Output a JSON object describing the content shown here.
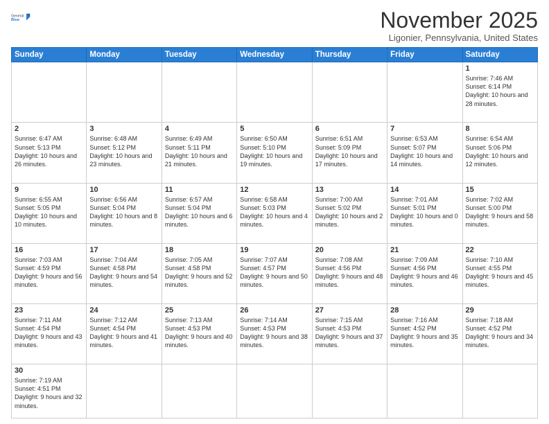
{
  "header": {
    "logo": {
      "line1": "General",
      "line2": "Blue"
    },
    "title": "November 2025",
    "location": "Ligonier, Pennsylvania, United States"
  },
  "weekdays": [
    "Sunday",
    "Monday",
    "Tuesday",
    "Wednesday",
    "Thursday",
    "Friday",
    "Saturday"
  ],
  "weeks": [
    [
      {
        "day": "",
        "info": ""
      },
      {
        "day": "",
        "info": ""
      },
      {
        "day": "",
        "info": ""
      },
      {
        "day": "",
        "info": ""
      },
      {
        "day": "",
        "info": ""
      },
      {
        "day": "",
        "info": ""
      },
      {
        "day": "1",
        "info": "Sunrise: 7:46 AM\nSunset: 6:14 PM\nDaylight: 10 hours\nand 28 minutes."
      }
    ],
    [
      {
        "day": "2",
        "info": "Sunrise: 6:47 AM\nSunset: 5:13 PM\nDaylight: 10 hours\nand 26 minutes."
      },
      {
        "day": "3",
        "info": "Sunrise: 6:48 AM\nSunset: 5:12 PM\nDaylight: 10 hours\nand 23 minutes."
      },
      {
        "day": "4",
        "info": "Sunrise: 6:49 AM\nSunset: 5:11 PM\nDaylight: 10 hours\nand 21 minutes."
      },
      {
        "day": "5",
        "info": "Sunrise: 6:50 AM\nSunset: 5:10 PM\nDaylight: 10 hours\nand 19 minutes."
      },
      {
        "day": "6",
        "info": "Sunrise: 6:51 AM\nSunset: 5:09 PM\nDaylight: 10 hours\nand 17 minutes."
      },
      {
        "day": "7",
        "info": "Sunrise: 6:53 AM\nSunset: 5:07 PM\nDaylight: 10 hours\nand 14 minutes."
      },
      {
        "day": "8",
        "info": "Sunrise: 6:54 AM\nSunset: 5:06 PM\nDaylight: 10 hours\nand 12 minutes."
      }
    ],
    [
      {
        "day": "9",
        "info": "Sunrise: 6:55 AM\nSunset: 5:05 PM\nDaylight: 10 hours\nand 10 minutes."
      },
      {
        "day": "10",
        "info": "Sunrise: 6:56 AM\nSunset: 5:04 PM\nDaylight: 10 hours\nand 8 minutes."
      },
      {
        "day": "11",
        "info": "Sunrise: 6:57 AM\nSunset: 5:04 PM\nDaylight: 10 hours\nand 6 minutes."
      },
      {
        "day": "12",
        "info": "Sunrise: 6:58 AM\nSunset: 5:03 PM\nDaylight: 10 hours\nand 4 minutes."
      },
      {
        "day": "13",
        "info": "Sunrise: 7:00 AM\nSunset: 5:02 PM\nDaylight: 10 hours\nand 2 minutes."
      },
      {
        "day": "14",
        "info": "Sunrise: 7:01 AM\nSunset: 5:01 PM\nDaylight: 10 hours\nand 0 minutes."
      },
      {
        "day": "15",
        "info": "Sunrise: 7:02 AM\nSunset: 5:00 PM\nDaylight: 9 hours\nand 58 minutes."
      }
    ],
    [
      {
        "day": "16",
        "info": "Sunrise: 7:03 AM\nSunset: 4:59 PM\nDaylight: 9 hours\nand 56 minutes."
      },
      {
        "day": "17",
        "info": "Sunrise: 7:04 AM\nSunset: 4:58 PM\nDaylight: 9 hours\nand 54 minutes."
      },
      {
        "day": "18",
        "info": "Sunrise: 7:05 AM\nSunset: 4:58 PM\nDaylight: 9 hours\nand 52 minutes."
      },
      {
        "day": "19",
        "info": "Sunrise: 7:07 AM\nSunset: 4:57 PM\nDaylight: 9 hours\nand 50 minutes."
      },
      {
        "day": "20",
        "info": "Sunrise: 7:08 AM\nSunset: 4:56 PM\nDaylight: 9 hours\nand 48 minutes."
      },
      {
        "day": "21",
        "info": "Sunrise: 7:09 AM\nSunset: 4:56 PM\nDaylight: 9 hours\nand 46 minutes."
      },
      {
        "day": "22",
        "info": "Sunrise: 7:10 AM\nSunset: 4:55 PM\nDaylight: 9 hours\nand 45 minutes."
      }
    ],
    [
      {
        "day": "23",
        "info": "Sunrise: 7:11 AM\nSunset: 4:54 PM\nDaylight: 9 hours\nand 43 minutes."
      },
      {
        "day": "24",
        "info": "Sunrise: 7:12 AM\nSunset: 4:54 PM\nDaylight: 9 hours\nand 41 minutes."
      },
      {
        "day": "25",
        "info": "Sunrise: 7:13 AM\nSunset: 4:53 PM\nDaylight: 9 hours\nand 40 minutes."
      },
      {
        "day": "26",
        "info": "Sunrise: 7:14 AM\nSunset: 4:53 PM\nDaylight: 9 hours\nand 38 minutes."
      },
      {
        "day": "27",
        "info": "Sunrise: 7:15 AM\nSunset: 4:53 PM\nDaylight: 9 hours\nand 37 minutes."
      },
      {
        "day": "28",
        "info": "Sunrise: 7:16 AM\nSunset: 4:52 PM\nDaylight: 9 hours\nand 35 minutes."
      },
      {
        "day": "29",
        "info": "Sunrise: 7:18 AM\nSunset: 4:52 PM\nDaylight: 9 hours\nand 34 minutes."
      }
    ],
    [
      {
        "day": "30",
        "info": "Sunrise: 7:19 AM\nSunset: 4:51 PM\nDaylight: 9 hours\nand 32 minutes."
      },
      {
        "day": "",
        "info": ""
      },
      {
        "day": "",
        "info": ""
      },
      {
        "day": "",
        "info": ""
      },
      {
        "day": "",
        "info": ""
      },
      {
        "day": "",
        "info": ""
      },
      {
        "day": "",
        "info": ""
      }
    ]
  ]
}
